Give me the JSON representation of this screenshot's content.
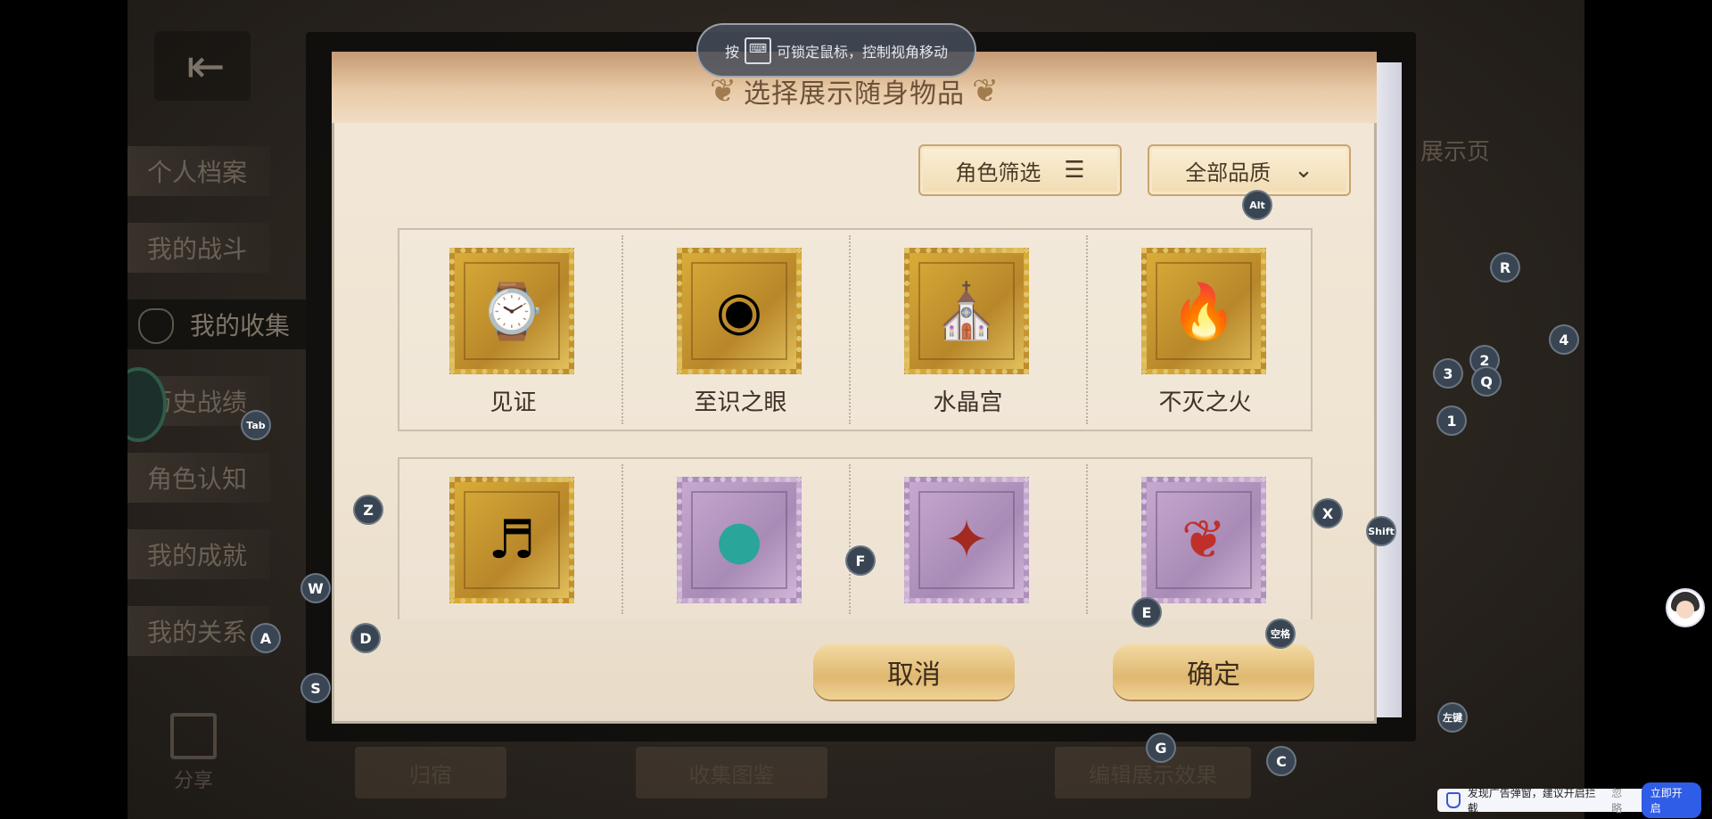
{
  "hint": {
    "prefix": "按",
    "key_glyph": "⌨",
    "text": "可锁定鼠标，控制视角移动"
  },
  "sidebar": {
    "items": [
      {
        "label": "个人档案"
      },
      {
        "label": "我的战斗"
      },
      {
        "label": "我的收集"
      },
      {
        "label": "历史战绩"
      },
      {
        "label": "角色认知"
      },
      {
        "label": "我的成就"
      },
      {
        "label": "我的关系"
      }
    ],
    "share_label": "分享"
  },
  "background": {
    "right_label": "展示页",
    "bottom_tabs": [
      {
        "label": "归宿"
      },
      {
        "label": "收集图鉴"
      },
      {
        "label": "编辑展示效果"
      }
    ]
  },
  "dialog": {
    "title": "选择展示随身物品",
    "filter_role": "角色筛选",
    "filter_quality": "全部品质",
    "items": [
      {
        "label": "见证",
        "quality": "gold",
        "icon": "watch-icon",
        "glyph": "⌚"
      },
      {
        "label": "至识之眼",
        "quality": "gold",
        "icon": "eye-icon",
        "glyph": "◉"
      },
      {
        "label": "水晶宫",
        "quality": "gold",
        "icon": "crystal-palace-icon",
        "glyph": "⛪"
      },
      {
        "label": "不灭之火",
        "quality": "gold",
        "icon": "torch-icon",
        "glyph": "🔥"
      },
      {
        "label": "",
        "quality": "gold",
        "icon": "harp-icon",
        "glyph": "♬"
      },
      {
        "label": "",
        "quality": "purple",
        "icon": "gem-icon",
        "glyph": "●"
      },
      {
        "label": "",
        "quality": "purple",
        "icon": "candy-icon",
        "glyph": "✦"
      },
      {
        "label": "",
        "quality": "purple",
        "icon": "cape-icon",
        "glyph": "❦"
      }
    ],
    "cancel_label": "取消",
    "confirm_label": "确定"
  },
  "key_markers": [
    {
      "key": "Alt"
    },
    {
      "key": "R"
    },
    {
      "key": "4"
    },
    {
      "key": "2"
    },
    {
      "key": "3"
    },
    {
      "key": "Q"
    },
    {
      "key": "1"
    },
    {
      "key": "Tab"
    },
    {
      "key": "Z"
    },
    {
      "key": "X"
    },
    {
      "key": "Shift"
    },
    {
      "key": "F"
    },
    {
      "key": "W"
    },
    {
      "key": "E"
    },
    {
      "key": "A"
    },
    {
      "key": "D"
    },
    {
      "key": "空格"
    },
    {
      "key": "S"
    },
    {
      "key": "左键"
    },
    {
      "key": "G"
    },
    {
      "key": "C"
    }
  ],
  "ad_bar": {
    "text": "发现广告弹窗，建议开启拦截",
    "ignore": "忽略",
    "enable": "立即开启"
  },
  "colors": {
    "gold_stamp": "#d9ac38",
    "purple_stamp": "#c7a8cf",
    "accent_blue": "#2f5de8"
  }
}
